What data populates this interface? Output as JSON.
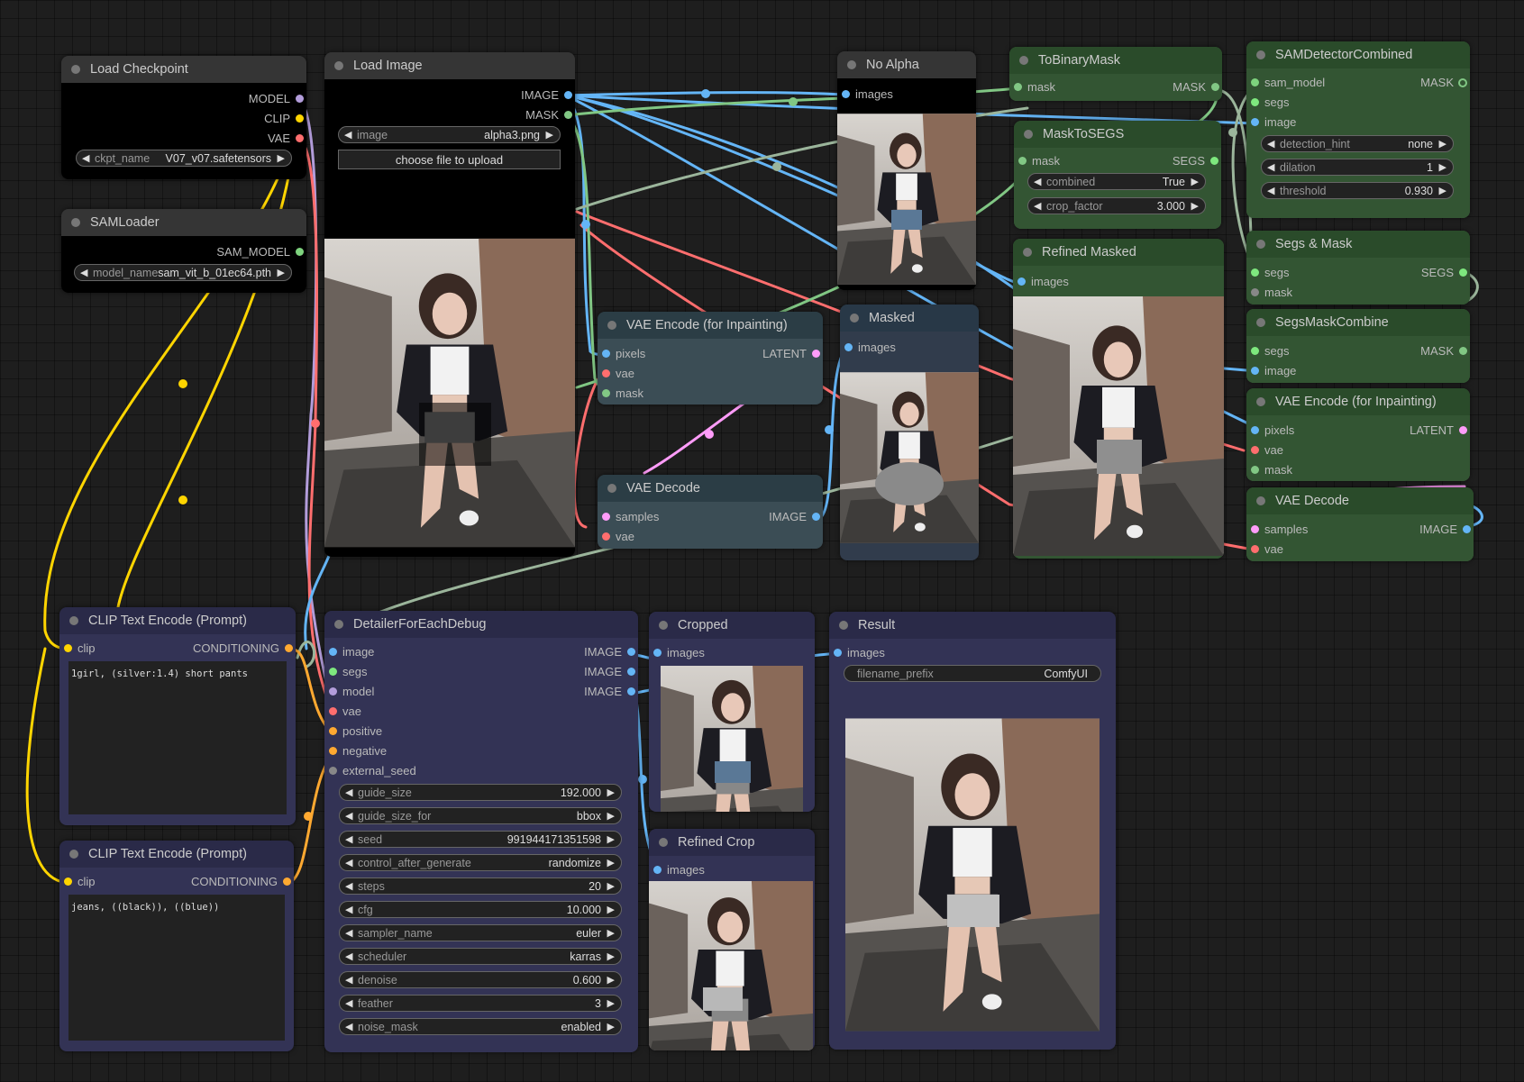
{
  "nodes": {
    "load_checkpoint": {
      "title": "Load Checkpoint",
      "outputs": [
        "MODEL",
        "CLIP",
        "VAE"
      ],
      "widget": {
        "label": "ckpt_name",
        "value": "V07_v07.safetensors"
      }
    },
    "sam_loader": {
      "title": "SAMLoader",
      "output": "SAM_MODEL",
      "widget": {
        "label": "model_name",
        "value": "sam_vit_b_01ec64.pth"
      }
    },
    "load_image": {
      "title": "Load Image",
      "outputs": [
        "IMAGE",
        "MASK"
      ],
      "widget": {
        "label": "image",
        "value": "alpha3.png"
      },
      "upload_button": "choose file to upload"
    },
    "vae_encode_1": {
      "title": "VAE Encode (for Inpainting)",
      "inputs": [
        "pixels",
        "vae",
        "mask"
      ],
      "output": "LATENT"
    },
    "vae_decode_1": {
      "title": "VAE Decode",
      "inputs": [
        "samples",
        "vae"
      ],
      "output": "IMAGE"
    },
    "no_alpha": {
      "title": "No Alpha",
      "input": "images"
    },
    "masked": {
      "title": "Masked",
      "input": "images"
    },
    "to_binary_mask": {
      "title": "ToBinaryMask",
      "input": "mask",
      "output": "MASK"
    },
    "mask_to_segs": {
      "title": "MaskToSEGS",
      "input": "mask",
      "output": "SEGS",
      "widgets": [
        {
          "label": "combined",
          "value": "True"
        },
        {
          "label": "crop_factor",
          "value": "3.000"
        }
      ]
    },
    "refined_masked": {
      "title": "Refined Masked",
      "input": "images"
    },
    "sam_detector": {
      "title": "SAMDetectorCombined",
      "inputs": [
        "sam_model",
        "segs",
        "image"
      ],
      "output": "MASK",
      "widgets": [
        {
          "label": "detection_hint",
          "value": "none"
        },
        {
          "label": "dilation",
          "value": "1"
        },
        {
          "label": "threshold",
          "value": "0.930"
        }
      ]
    },
    "segs_mask": {
      "title": "Segs & Mask",
      "inputs": [
        "segs",
        "mask"
      ],
      "output": "SEGS"
    },
    "segs_mask_combine": {
      "title": "SegsMaskCombine",
      "inputs": [
        "segs",
        "image"
      ],
      "output": "MASK"
    },
    "vae_encode_2": {
      "title": "VAE Encode (for Inpainting)",
      "inputs": [
        "pixels",
        "vae",
        "mask"
      ],
      "output": "LATENT"
    },
    "vae_decode_2": {
      "title": "VAE Decode",
      "inputs": [
        "samples",
        "vae"
      ],
      "output": "IMAGE"
    },
    "clip_pos": {
      "title": "CLIP Text Encode (Prompt)",
      "input": "clip",
      "output": "CONDITIONING",
      "text": "1girl, (silver:1.4) short pants"
    },
    "clip_neg": {
      "title": "CLIP Text Encode (Prompt)",
      "input": "clip",
      "output": "CONDITIONING",
      "text": "jeans, ((black)), ((blue))"
    },
    "detailer": {
      "title": "DetailerForEachDebug",
      "inputs": [
        "image",
        "segs",
        "model",
        "vae",
        "positive",
        "negative",
        "external_seed"
      ],
      "outputs": [
        "IMAGE",
        "IMAGE",
        "IMAGE"
      ],
      "widgets": [
        {
          "label": "guide_size",
          "value": "192.000"
        },
        {
          "label": "guide_size_for",
          "value": "bbox"
        },
        {
          "label": "seed",
          "value": "991944171351598"
        },
        {
          "label": "control_after_generate",
          "value": "randomize"
        },
        {
          "label": "steps",
          "value": "20"
        },
        {
          "label": "cfg",
          "value": "10.000"
        },
        {
          "label": "sampler_name",
          "value": "euler"
        },
        {
          "label": "scheduler",
          "value": "karras"
        },
        {
          "label": "denoise",
          "value": "0.600"
        },
        {
          "label": "feather",
          "value": "3"
        },
        {
          "label": "noise_mask",
          "value": "enabled"
        }
      ]
    },
    "cropped": {
      "title": "Cropped",
      "input": "images"
    },
    "refined_crop": {
      "title": "Refined Crop",
      "input": "images"
    },
    "result": {
      "title": "Result",
      "input": "images",
      "widget": {
        "label": "filename_prefix",
        "value": "ComfyUI"
      }
    }
  },
  "colors": {
    "model": "#b39ddb",
    "clip": "#ffd500",
    "vae": "#ff6e6e",
    "image": "#64b5f6",
    "mask": "#81c784",
    "latent": "#ff9cf9",
    "conditioning": "#ffa931",
    "segs": "#9bb59b"
  }
}
